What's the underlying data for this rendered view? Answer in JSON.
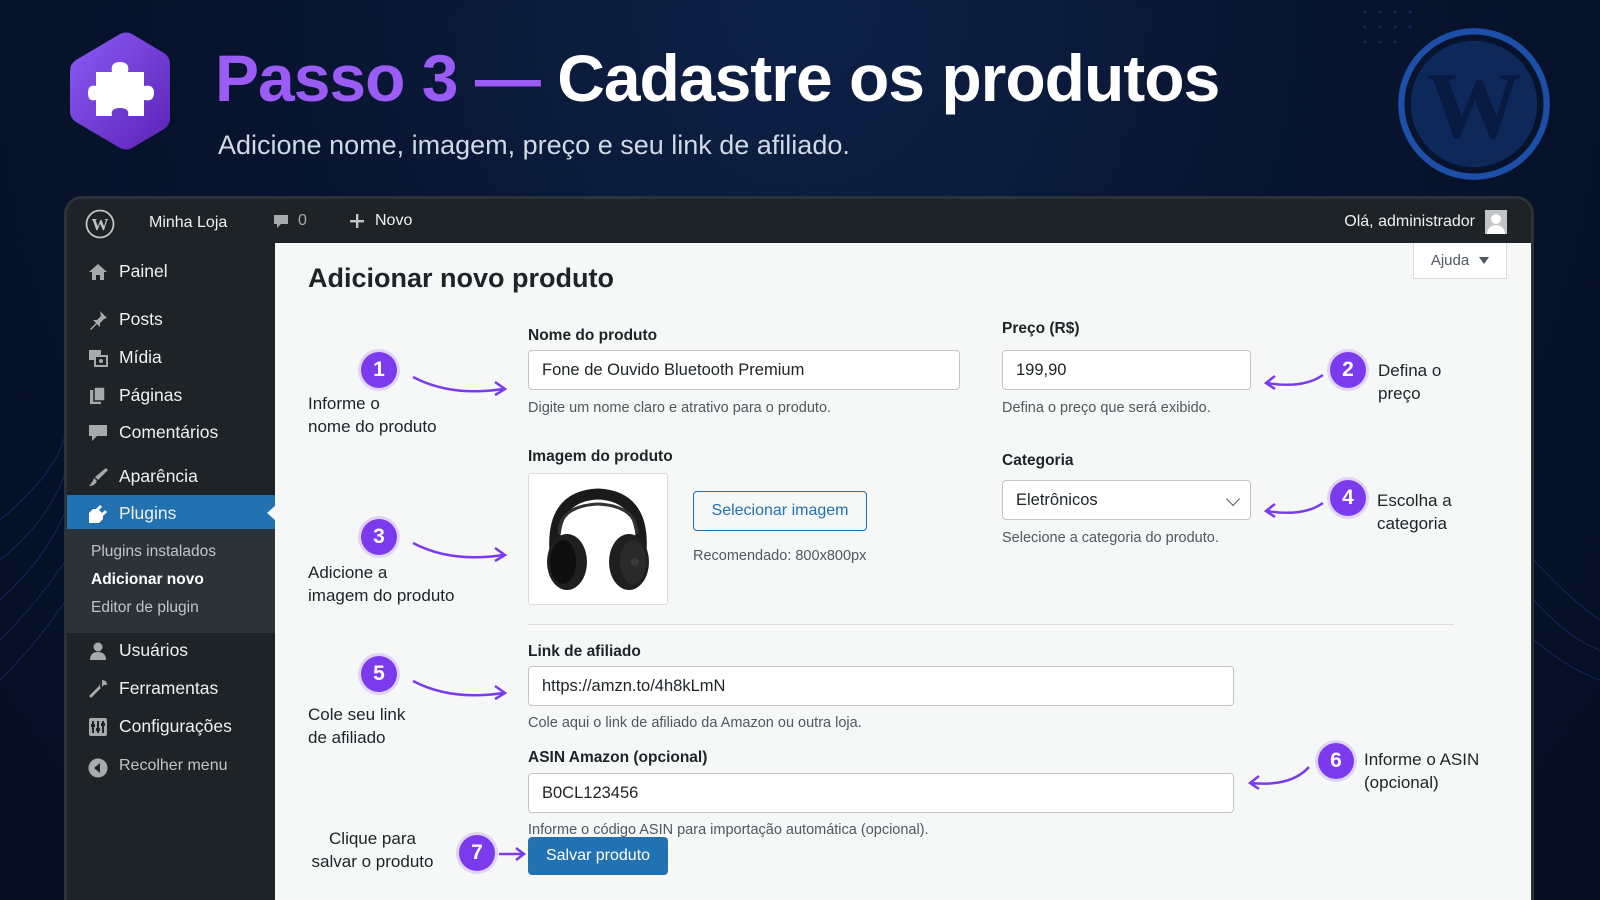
{
  "header": {
    "title_accent": "Passo 3",
    "title_dash": "—",
    "title_rest": "Cadastre os produtos",
    "subtitle": "Adicione nome, imagem, preço e seu link de afiliado."
  },
  "adminbar": {
    "site_name": "Minha Loja",
    "comments_count": "0",
    "new_label": "Novo",
    "greeting": "Olá, administrador"
  },
  "sidebar": {
    "items": [
      {
        "label": "Painel",
        "icon": "home-icon"
      },
      {
        "label": "Posts",
        "icon": "pin-icon"
      },
      {
        "label": "Mídia",
        "icon": "media-icon"
      },
      {
        "label": "Páginas",
        "icon": "pages-icon"
      },
      {
        "label": "Comentários",
        "icon": "comment-icon"
      },
      {
        "label": "Aparência",
        "icon": "brush-icon"
      },
      {
        "label": "Plugins",
        "icon": "plugin-icon"
      },
      {
        "label": "Usuários",
        "icon": "user-icon"
      },
      {
        "label": "Ferramentas",
        "icon": "wrench-icon"
      },
      {
        "label": "Configurações",
        "icon": "settings-icon"
      }
    ],
    "submenu": [
      "Plugins instalados",
      "Adicionar novo",
      "Editor de plugin"
    ],
    "collapse_label": "Recolher menu"
  },
  "content": {
    "help_label": "Ajuda",
    "page_title": "Adicionar novo produto",
    "name_label": "Nome do produto",
    "name_value": "Fone de Ouvido Bluetooth Premium",
    "name_desc": "Digite um nome claro e atrativo para o produto.",
    "price_label": "Preço (R$)",
    "price_value": "199,90",
    "price_desc": "Defina o preço que será exibido.",
    "image_label": "Imagem do produto",
    "select_image_label": "Selecionar imagem",
    "image_hint": "Recomendado: 800x800px",
    "category_label": "Categoria",
    "category_value": "Eletrônicos",
    "category_desc": "Selecione a categoria do produto.",
    "link_label": "Link de afiliado",
    "link_value": "https://amzn.to/4h8kLmN",
    "link_desc": "Cole aqui o link de afiliado da Amazon ou outra loja.",
    "asin_label": "ASIN Amazon (opcional)",
    "asin_value": "B0CL123456",
    "asin_desc": "Informe o código ASIN para importação automática (opcional).",
    "save_label": "Salvar produto"
  },
  "annotations": [
    {
      "n": "1",
      "line1": "Informe o",
      "line2": "nome do produto"
    },
    {
      "n": "2",
      "line1": "Defina o",
      "line2": "preço"
    },
    {
      "n": "3",
      "line1": "Adicione a",
      "line2": "imagem do produto"
    },
    {
      "n": "4",
      "line1": "Escolha a",
      "line2": "categoria"
    },
    {
      "n": "5",
      "line1": "Cole seu link",
      "line2": "de afiliado"
    },
    {
      "n": "6",
      "line1": "Informe o ASIN",
      "line2": "(opcional)"
    },
    {
      "n": "7",
      "line1": "Clique para",
      "line2": "salvar o produto"
    }
  ],
  "colors": {
    "accent_purple": "#9b5cf6",
    "badge_purple": "#7c3aed",
    "wp_blue": "#2271b1",
    "admin_dark": "#1d2327",
    "page_bg": "#081530"
  }
}
